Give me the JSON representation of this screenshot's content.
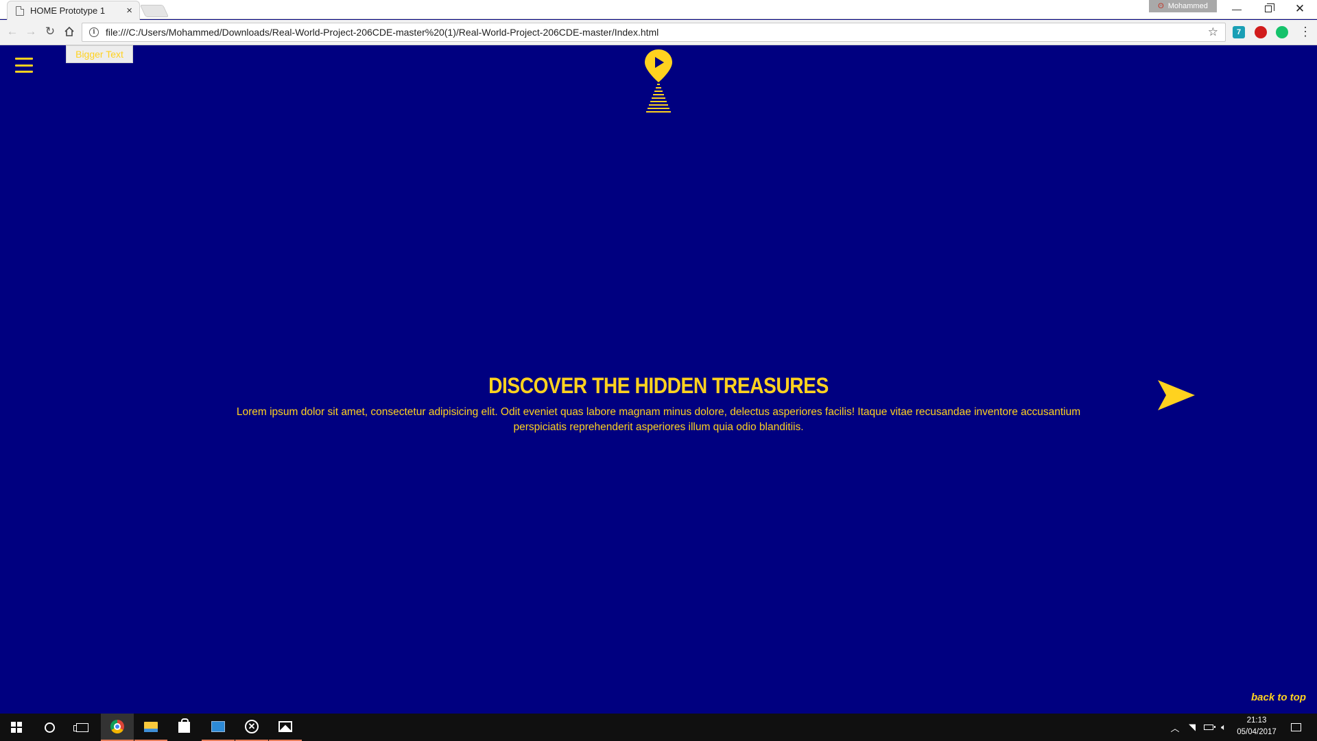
{
  "browser": {
    "tab_title": "HOME Prototype 1",
    "tab_close": "×",
    "profile_name": "Mohammed",
    "url": "file:///C:/Users/Mohammed/Downloads/Real-World-Project-206CDE-master%20(1)/Real-World-Project-206CDE-master/Index.html",
    "extension_badge": "7"
  },
  "page": {
    "bigger_text_button": "Bigger Text",
    "hero_title": "DISCOVER THE HIDDEN TREASURES",
    "hero_body": "Lorem ipsum dolor sit amet, consectetur adipisicing elit. Odit eveniet quas labore magnam minus dolore, delectus asperiores facilis! Itaque vitae recusandae inventore accusantium perspiciatis reprehenderit asperiores illum quia odio blanditiis.",
    "back_to_top": "back to top",
    "colors": {
      "background": "#000080",
      "accent": "#ffd21f"
    }
  },
  "taskbar": {
    "time": "21:13",
    "date": "05/04/2017"
  }
}
